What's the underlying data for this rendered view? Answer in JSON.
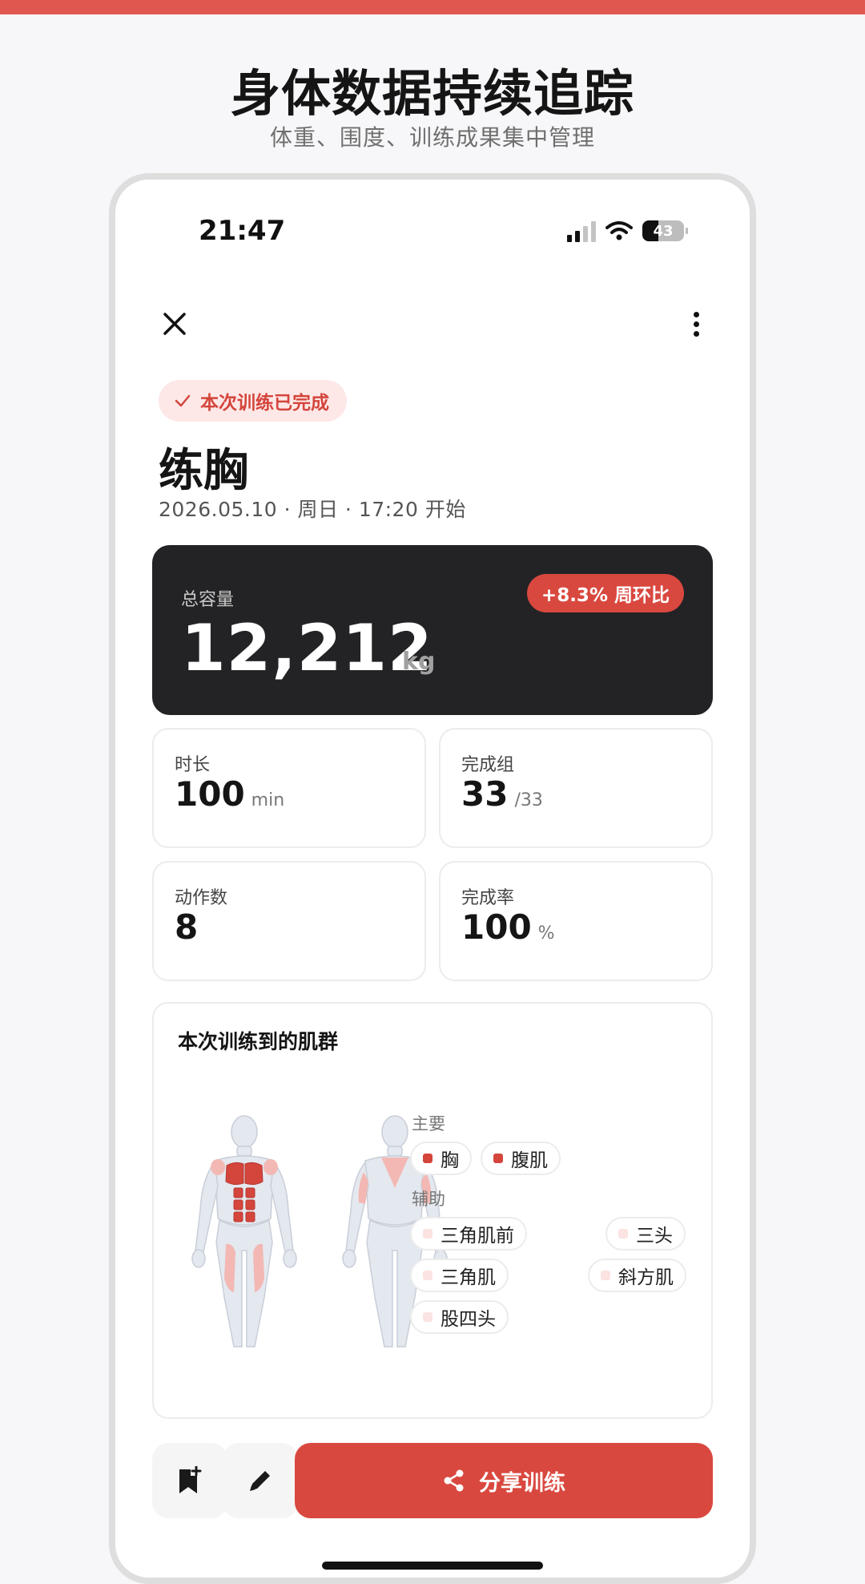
{
  "promo": {
    "title": "身体数据持续追踪",
    "subtitle": "体重、围度、训练成果集中管理"
  },
  "status_bar": {
    "time": "21:47",
    "battery_level": "43"
  },
  "header": {
    "close_icon": "close-icon",
    "more_icon": "more-vertical-icon"
  },
  "workout": {
    "status_badge": "本次训练已完成",
    "title": "练胸",
    "meta": "2026.05.10 · 周日 · 17:20 开始"
  },
  "volume": {
    "label": "总容量",
    "value": "12,212",
    "unit": "kg",
    "change": "+8.3% 周环比"
  },
  "stats": {
    "duration": {
      "label": "时长",
      "value": "100",
      "unit": "min"
    },
    "sets": {
      "label": "完成组",
      "value": "33",
      "unit": "/33"
    },
    "exercises": {
      "label": "动作数",
      "value": "8"
    },
    "completion": {
      "label": "完成率",
      "value": "100",
      "unit": "%"
    }
  },
  "muscles": {
    "title": "本次训练到的肌群",
    "primary_label": "主要",
    "primary": [
      "胸",
      "腹肌"
    ],
    "secondary_label": "辅助",
    "secondary": [
      "三角肌前",
      "三头",
      "三角肌",
      "斜方肌",
      "股四头"
    ]
  },
  "actions": {
    "bookmark_icon": "bookmark-add-icon",
    "edit_icon": "edit-pencil-icon",
    "share_label": "分享训练"
  },
  "colors": {
    "accent": "#d9483f",
    "dark_card": "#232326",
    "badge_bg": "#fde8e7"
  }
}
